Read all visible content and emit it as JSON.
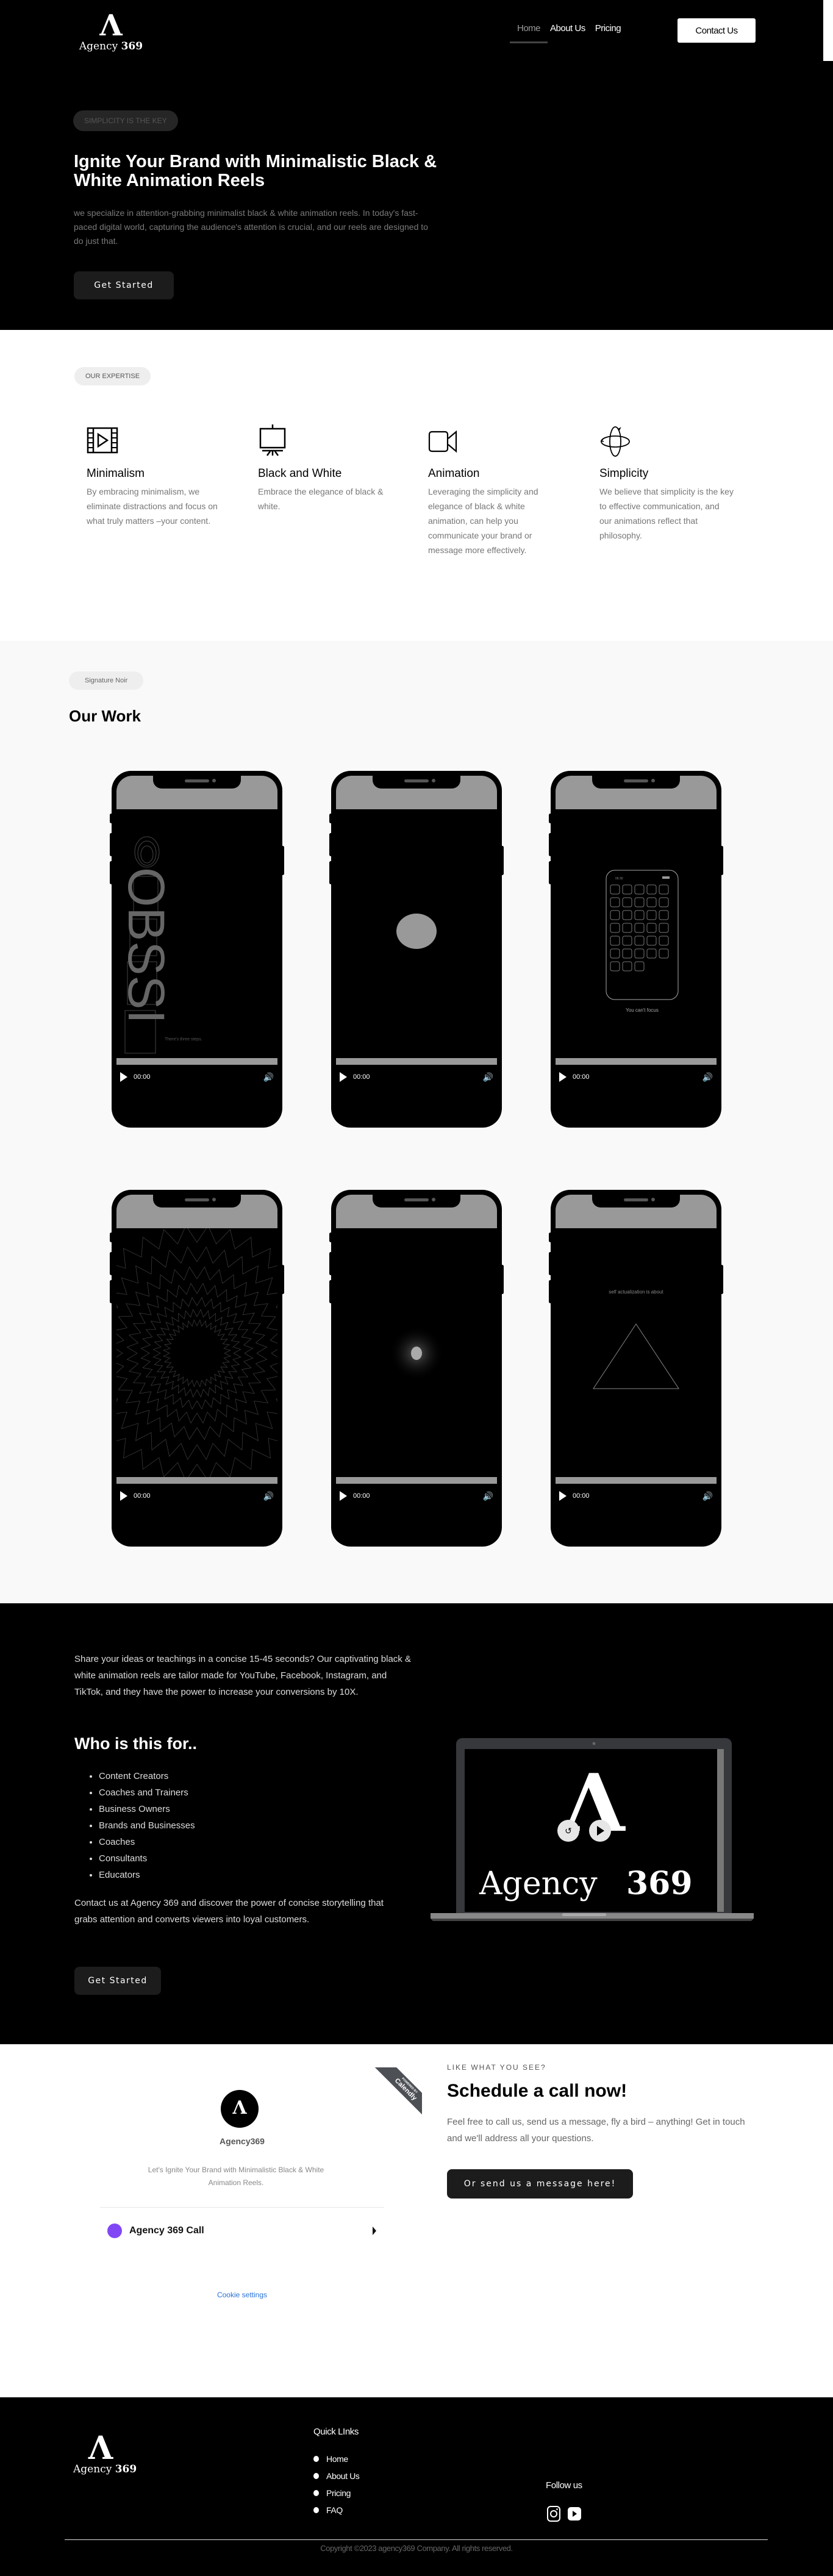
{
  "header": {
    "logo": {
      "mark": "Λ",
      "name_light": "Agency",
      "name_bold": "369"
    },
    "nav": [
      {
        "label": "Home",
        "active": true
      },
      {
        "label": "About Us",
        "active": false
      },
      {
        "label": "Pricing",
        "active": false
      }
    ],
    "contact_button": "Contact Us"
  },
  "hero": {
    "tag": "SIMPLICITY IS THE KEY",
    "title": "Ignite Your Brand with Minimalistic Black & White Animation Reels",
    "description": "we specialize in attention-grabbing minimalist black & white animation reels. In today's fast-paced digital world, capturing the audience's attention is crucial, and our reels are designed to do just that.",
    "cta": "Get Started"
  },
  "expertise": {
    "tag": "OUR EXPERTISE",
    "features": [
      {
        "icon": "film-play-icon",
        "title": "Minimalism",
        "text": "By embracing minimalism, we eliminate distractions and focus on what truly matters –your content."
      },
      {
        "icon": "easel-icon",
        "title": "Black and White",
        "text": "Embrace the elegance of black & white."
      },
      {
        "icon": "video-camera-icon",
        "title": "Animation",
        "text": "Leveraging the simplicity and elegance of black & white animation, can help you communicate your brand or message more effectively."
      },
      {
        "icon": "rotate-3d-icon",
        "title": "Simplicity",
        "text": "We believe that simplicity is the key to effective communication, and our animations reflect that philosophy."
      }
    ]
  },
  "work": {
    "tag": "Signature Noir",
    "title": "Our Work",
    "videos": [
      {
        "scene": "obsession-text",
        "caption": "There's three steps.",
        "overlay": "OBSSI",
        "time": "00:00"
      },
      {
        "scene": "gray-circle",
        "caption": "",
        "time": "00:00"
      },
      {
        "scene": "app-grid-phone",
        "caption": "You can't focus",
        "mini_time": "06:30",
        "time": "00:00"
      },
      {
        "scene": "radial-zigzag",
        "caption": "",
        "time": "00:00"
      },
      {
        "scene": "glowing-dot",
        "caption": "",
        "time": "00:00"
      },
      {
        "scene": "triangle",
        "caption": "self actualization is about",
        "time": "00:00"
      }
    ]
  },
  "who": {
    "intro": "Share your ideas or teachings in a concise 15-45 seconds? Our captivating black & white animation reels are tailor made for YouTube, Facebook, Instagram, and TikTok, and they have the power to increase your conversions by 10X.",
    "title": "Who is this for..",
    "audience": [
      "Content Creators",
      "Coaches and Trainers",
      "Business Owners",
      "Brands and Businesses",
      "Coaches",
      "Consultants",
      "Educators"
    ],
    "outro": "Contact us at Agency 369 and discover the power of concise storytelling that grabs attention and converts  viewers into loyal customers.",
    "cta": "Get Started",
    "laptop": {
      "mark": "Λ",
      "name_light": "Agency",
      "name_bold": "369"
    }
  },
  "contact": {
    "calendly": {
      "ribbon_small": "POWERED BY",
      "ribbon_brand": "Calendly",
      "logo_mark": "Λ",
      "name": "Agency369",
      "description": "Let's Ignite Your Brand with Minimalistic Black & White Animation Reels.",
      "event": {
        "name": "Agency 369 Call",
        "color": "#8247f5"
      },
      "cookie_settings": "Cookie settings"
    },
    "kicker": "LIKE WHAT YOU SEE?",
    "title": "Schedule a call now!",
    "lead": "Feel free to call us, send us a message, fly a bird – anything! Get in touch and we'll address all your questions.",
    "cta": "Or send us a message here!"
  },
  "footer": {
    "logo": {
      "mark": "Λ",
      "name_light": "Agency",
      "name_bold": "369"
    },
    "quick_links_title": "Quick LInks",
    "quick_links": [
      "Home",
      "About Us",
      "Pricing",
      "FAQ"
    ],
    "follow_title": "Follow us",
    "socials": [
      {
        "icon": "instagram-icon"
      },
      {
        "icon": "youtube-icon"
      }
    ],
    "copyright": "Copyright ©2023 agency369 Company. All rights reserved."
  }
}
